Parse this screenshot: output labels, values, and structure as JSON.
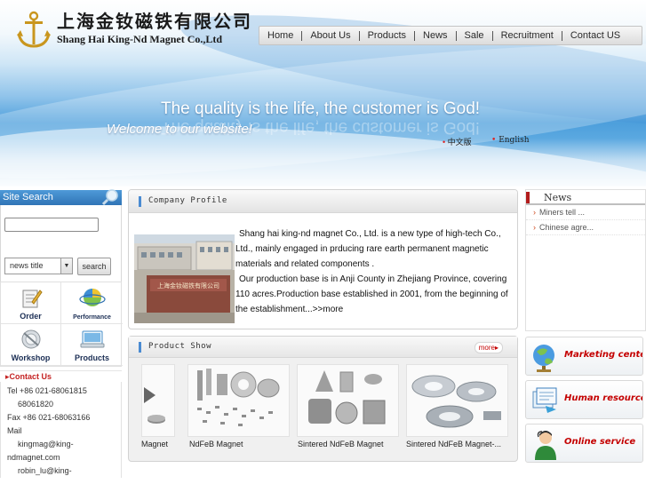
{
  "brand": {
    "name_cn": "上海金钕磁铁有限公司",
    "name_en": "Shang Hai King-Nd Magnet Co.,Ltd"
  },
  "nav": [
    "Home",
    "About Us",
    "Products",
    "News",
    "Sale",
    "Recruitment",
    "Contact US"
  ],
  "banner": {
    "slogan": "The quality is the life, the customer is God!",
    "welcome": "Welcome to our website!",
    "lang_cn": "中文版",
    "lang_en": "English"
  },
  "site_search": {
    "title": "Site Search",
    "query": "",
    "select_value": "news title",
    "button": "search"
  },
  "quick_links": [
    {
      "label": "Order",
      "icon": "order-icon"
    },
    {
      "label": "Performance",
      "icon": "performance-icon"
    },
    {
      "label": "Workshop",
      "icon": "workshop-icon"
    },
    {
      "label": "Products",
      "icon": "products-icon"
    }
  ],
  "contact": {
    "title": "Contact Us",
    "tel_label": "Tel +86 021-68061815",
    "tel2": "68061820",
    "fax": "Fax +86 021-68063166",
    "mail_label": "Mail",
    "mail1": "kingmag@king-",
    "mail1b": "ndmagnet.com",
    "mail2": "robin_lu@king-"
  },
  "profile": {
    "title": "Company Profile",
    "para1": "Shang hai king-nd magnet Co., Ltd. is a new type of high-tech Co., Ltd., mainly engaged in prducing rare earth permanent magnetic materials and related components .",
    "para2": "Our production base is in Anji County in Zhejiang Province, covering 110 acres.Production base established in 2001, from the beginning of the establishment...>>more",
    "sign_text": "上海金钕磁铁有限公司"
  },
  "products": {
    "title": "Product Show",
    "more": "more",
    "items": [
      "Magnet",
      "NdFeB Magnet",
      "Sintered NdFeB Magnet",
      "Sintered NdFeB Magnet-..."
    ]
  },
  "news": {
    "title": "News",
    "items": [
      "Miners tell ...",
      "Chinese agre..."
    ]
  },
  "services": [
    {
      "label": "Marketing center",
      "icon": "globe-icon"
    },
    {
      "label": "Human resources",
      "icon": "documents-icon"
    },
    {
      "label": "Online  service",
      "icon": "support-person-icon"
    }
  ],
  "colors": {
    "accent_blue": "#2f74b6",
    "accent_red": "#c40000",
    "news_mark": "#b21d1d"
  }
}
